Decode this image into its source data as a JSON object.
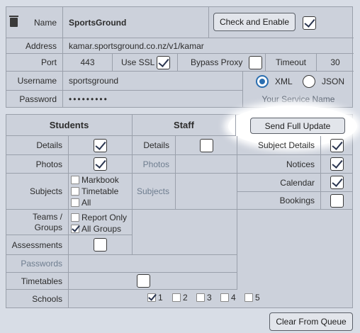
{
  "connection": {
    "name_label": "Name",
    "name_value": "SportsGround",
    "check_button": "Check and Enable",
    "enabled": true,
    "address_label": "Address",
    "address_value": "kamar.sportsground.co.nz/v1/kamar",
    "port_label": "Port",
    "port_value": "443",
    "ssl_label": "Use SSL",
    "ssl_checked": true,
    "proxy_label": "Bypass Proxy",
    "proxy_checked": false,
    "timeout_label": "Timeout",
    "timeout_value": "30",
    "username_label": "Username",
    "username_value": "sportsground",
    "format_xml": "XML",
    "format_json": "JSON",
    "format_selected": "XML",
    "password_label": "Password",
    "password_value": "•••••••••",
    "service_name": "Your Service Name"
  },
  "students": {
    "header": "Students",
    "details_label": "Details",
    "details_checked": true,
    "photos_label": "Photos",
    "photos_checked": true,
    "subjects_label": "Subjects",
    "subjects_options": [
      {
        "label": "Markbook",
        "checked": false
      },
      {
        "label": "Timetable",
        "checked": false
      },
      {
        "label": "All",
        "checked": false
      }
    ],
    "teams_label_line1": "Teams /",
    "teams_label_line2": "Groups",
    "teams_options": [
      {
        "label": "Report Only",
        "checked": false
      },
      {
        "label": "All Groups",
        "checked": true
      }
    ],
    "assessments_label": "Assessments",
    "assessments_checked": false,
    "passwords_label": "Passwords",
    "timetables_label": "Timetables",
    "timetables_checked": false,
    "schools_label": "Schools",
    "schools": [
      {
        "label": "1",
        "checked": true
      },
      {
        "label": "2",
        "checked": false
      },
      {
        "label": "3",
        "checked": false
      },
      {
        "label": "4",
        "checked": false
      },
      {
        "label": "5",
        "checked": false
      }
    ]
  },
  "staff": {
    "header": "Staff",
    "details_label": "Details",
    "details_checked": false,
    "photos_label": "Photos",
    "subjects_label": "Subjects"
  },
  "other": {
    "send_button": "Send Full Update",
    "subject_details_label": "Subject Details",
    "subject_details_checked": true,
    "notices_label": "Notices",
    "notices_checked": true,
    "calendar_label": "Calendar",
    "calendar_checked": true,
    "bookings_label": "Bookings",
    "bookings_checked": false
  },
  "footer": {
    "clear_button": "Clear From Queue"
  }
}
